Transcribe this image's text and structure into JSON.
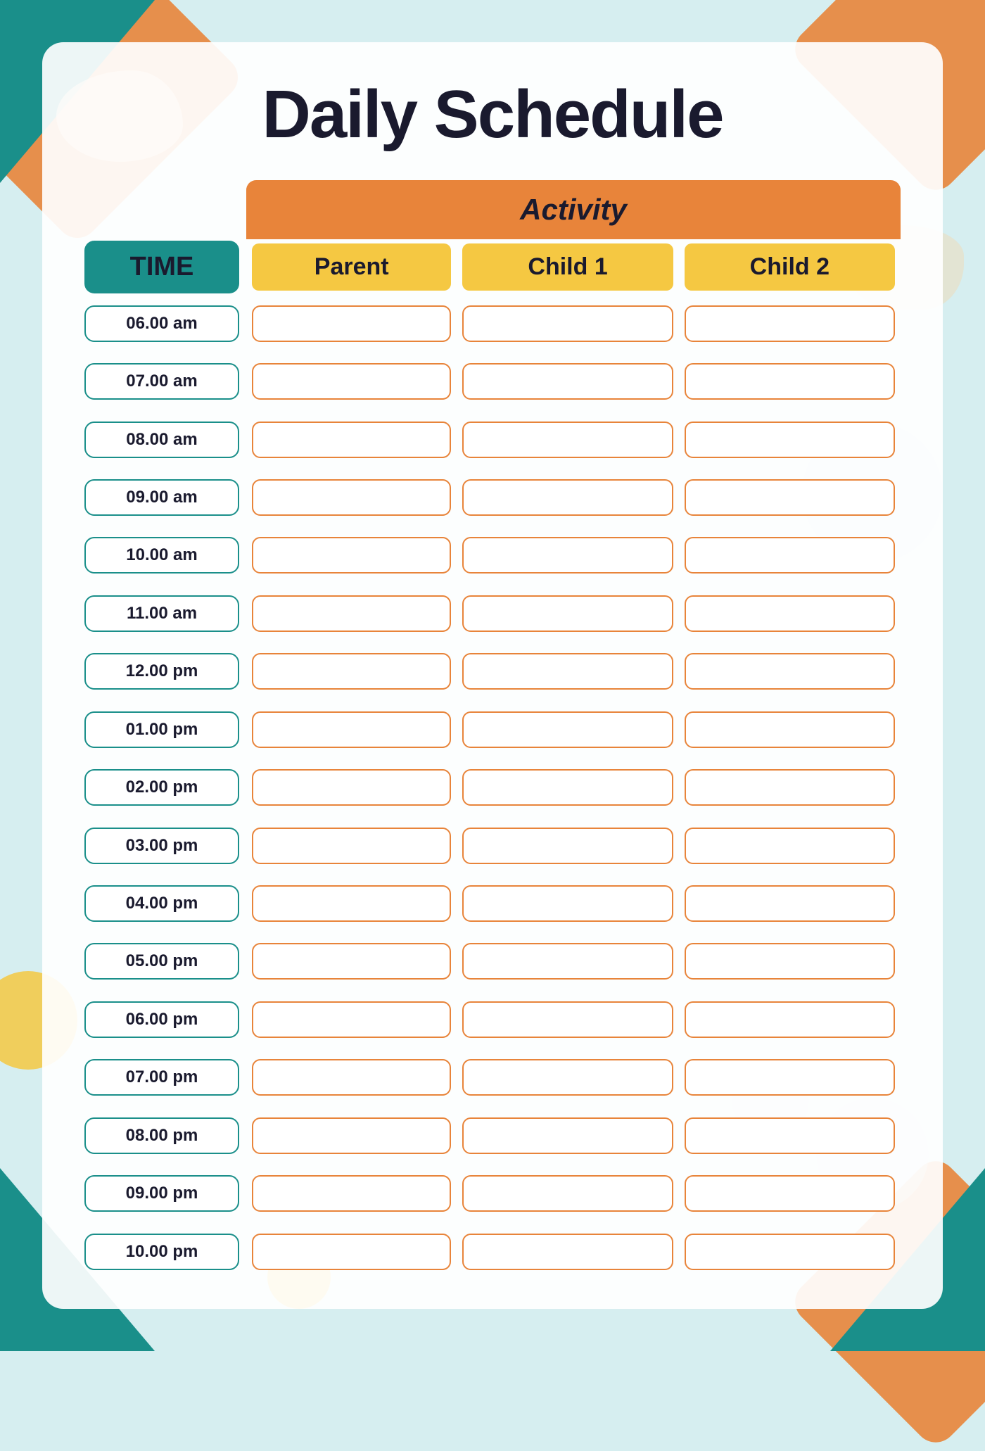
{
  "title": "Daily Schedule",
  "time_label": "TIME",
  "activity_label": "Activity",
  "columns": [
    "Parent",
    "Child 1",
    "Child 2"
  ],
  "times": [
    "06.00 am",
    "07.00 am",
    "08.00 am",
    "09.00 am",
    "10.00 am",
    "11.00 am",
    "12.00 pm",
    "01.00 pm",
    "02.00 pm",
    "03.00 pm",
    "04.00 pm",
    "05.00 pm",
    "06.00 pm",
    "07.00 pm",
    "08.00 pm",
    "09.00 pm",
    "10.00 pm"
  ],
  "colors": {
    "teal": "#1a8f8a",
    "orange": "#e8843a",
    "yellow": "#f5c842",
    "background": "#d6eef0",
    "card_bg": "rgba(255,255,255,0.92)"
  }
}
